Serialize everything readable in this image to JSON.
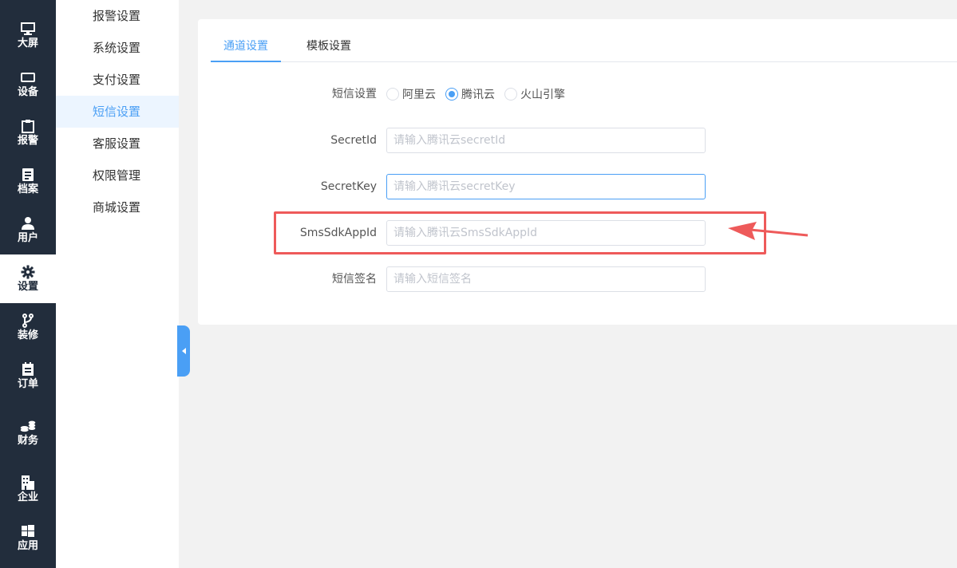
{
  "rail": {
    "items": [
      {
        "label": "大屏",
        "icon": "monitor-icon"
      },
      {
        "label": "设备",
        "icon": "device-icon"
      },
      {
        "label": "报警",
        "icon": "clipboard-icon"
      },
      {
        "label": "档案",
        "icon": "file-icon"
      },
      {
        "label": "用户",
        "icon": "user-icon"
      },
      {
        "label": "设置",
        "icon": "gear-icon"
      },
      {
        "label": "装修",
        "icon": "branch-icon"
      },
      {
        "label": "订单",
        "icon": "order-icon"
      },
      {
        "label": "财务",
        "icon": "coins-icon"
      },
      {
        "label": "企业",
        "icon": "building-icon"
      },
      {
        "label": "应用",
        "icon": "windows-icon"
      }
    ],
    "active_index": 5
  },
  "subnav": {
    "items": [
      "报警设置",
      "系统设置",
      "支付设置",
      "短信设置",
      "客服设置",
      "权限管理",
      "商城设置"
    ],
    "active_index": 3
  },
  "tabs": [
    "通道设置",
    "模板设置"
  ],
  "active_tab": 0,
  "form": {
    "provider_label": "短信设置",
    "providers": [
      "阿里云",
      "腾讯云",
      "火山引擎"
    ],
    "selected_provider": "腾讯云",
    "secret_id_label": "SecretId",
    "secret_id_placeholder": "请输入腾讯云secretId",
    "secret_key_label": "SecretKey",
    "secret_key_placeholder": "请输入腾讯云secretKey",
    "app_id_label": "SmsSdkAppId",
    "app_id_placeholder": "请输入腾讯云SmsSdkAppId",
    "sign_label": "短信签名",
    "sign_placeholder": "请输入短信签名"
  },
  "colors": {
    "accent": "#4a9ff5",
    "rail_bg": "#222d3c",
    "highlight": "#ee5a5a"
  }
}
